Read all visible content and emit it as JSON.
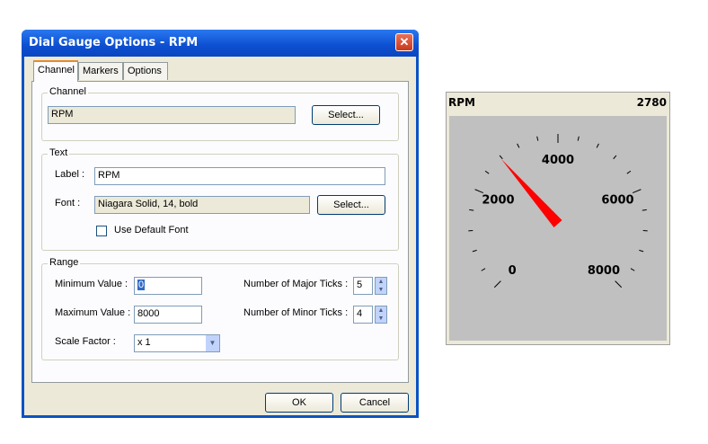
{
  "dialog": {
    "title": "Dial Gauge Options - RPM",
    "tabs": [
      {
        "label": "Channel"
      },
      {
        "label": "Markers"
      },
      {
        "label": "Options"
      }
    ],
    "channel_group": {
      "legend": "Channel",
      "value": "RPM",
      "select_label": "Select..."
    },
    "text_group": {
      "legend": "Text",
      "label_caption": "Label :",
      "label_value": "RPM",
      "font_caption": "Font :",
      "font_value": "Niagara Solid, 14, bold",
      "select_label": "Select...",
      "default_font_label": "Use Default Font",
      "default_font_checked": false
    },
    "range_group": {
      "legend": "Range",
      "min_caption": "Minimum Value :",
      "min_value": "0",
      "max_caption": "Maximum Value :",
      "max_value": "8000",
      "scale_caption": "Scale Factor :",
      "scale_value": "x 1",
      "major_caption": "Number of Major Ticks :",
      "major_value": "5",
      "minor_caption": "Number of Minor Ticks :",
      "minor_value": "4"
    },
    "ok_label": "OK",
    "cancel_label": "Cancel"
  },
  "gauge": {
    "title": "RPM",
    "value_text": "2780",
    "value": 2780,
    "min": 0,
    "max": 8000,
    "major_labels": [
      "0",
      "2000",
      "4000",
      "6000",
      "8000"
    ],
    "minor_ticks_per_major": 4,
    "needle_color": "#ff0000",
    "face_color": "#c0c0c0"
  }
}
